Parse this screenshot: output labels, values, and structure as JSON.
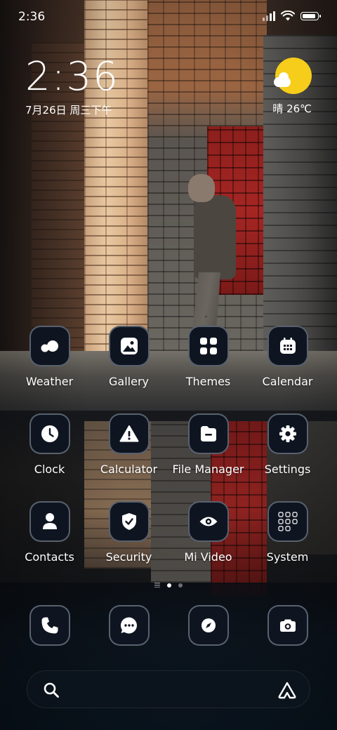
{
  "status_bar": {
    "time": "2:36",
    "icons": [
      "signal-icon",
      "wifi-icon",
      "battery-icon"
    ]
  },
  "clock_widget": {
    "time": "2:36",
    "date": "7月26日 周三下午"
  },
  "weather_widget": {
    "icon": "partly-sunny-icon",
    "text": "晴 26℃"
  },
  "apps": [
    {
      "label": "Weather",
      "icon": "weather-icon"
    },
    {
      "label": "Gallery",
      "icon": "gallery-icon"
    },
    {
      "label": "Themes",
      "icon": "themes-icon"
    },
    {
      "label": "Calendar",
      "icon": "calendar-icon"
    },
    {
      "label": "Clock",
      "icon": "clock-icon"
    },
    {
      "label": "Calculator",
      "icon": "calculator-icon"
    },
    {
      "label": "File Manager",
      "icon": "file-manager-icon"
    },
    {
      "label": "Settings",
      "icon": "settings-icon"
    },
    {
      "label": "Contacts",
      "icon": "contacts-icon"
    },
    {
      "label": "Security",
      "icon": "security-icon"
    },
    {
      "label": "Mi Video",
      "icon": "mi-video-icon"
    },
    {
      "label": "System",
      "icon": "system-folder-icon"
    }
  ],
  "page_indicator": {
    "pages": 3,
    "current": 2
  },
  "dock": [
    {
      "icon": "phone-icon"
    },
    {
      "icon": "messages-icon"
    },
    {
      "icon": "browser-icon"
    },
    {
      "icon": "camera-icon"
    }
  ],
  "search_bar": {
    "icons": [
      "search-icon",
      "assistant-icon"
    ]
  },
  "colors": {
    "icon_bg": "#0f1520",
    "sun": "#f5cd1a",
    "text": "#ffffff"
  }
}
